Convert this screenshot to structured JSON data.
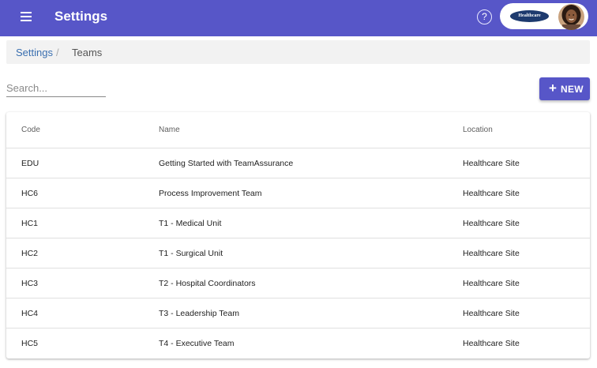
{
  "appbar": {
    "title": "Settings",
    "help_symbol": "?",
    "org_logo_text": "Healthcare",
    "icons": {
      "menu": "hamburger-menu-icon",
      "help": "help-circle-icon"
    }
  },
  "breadcrumb": {
    "parent": "Settings",
    "separator": "/",
    "current": "Teams"
  },
  "search": {
    "placeholder": "Search..."
  },
  "new_button": {
    "icon": "+",
    "label": "NEW"
  },
  "table": {
    "columns": [
      "Code",
      "Name",
      "Location"
    ],
    "rows": [
      {
        "code": "EDU",
        "name": "Getting Started with TeamAssurance",
        "location": "Healthcare Site"
      },
      {
        "code": "HC6",
        "name": "Process Improvement Team",
        "location": "Healthcare Site"
      },
      {
        "code": "HC1",
        "name": "T1 - Medical Unit",
        "location": "Healthcare Site"
      },
      {
        "code": "HC2",
        "name": "T1 - Surgical Unit",
        "location": "Healthcare Site"
      },
      {
        "code": "HC3",
        "name": "T2 - Hospital Coordinators",
        "location": "Healthcare Site"
      },
      {
        "code": "HC4",
        "name": "T3 - Leadership Team",
        "location": "Healthcare Site"
      },
      {
        "code": "HC5",
        "name": "T4 - Executive Team",
        "location": "Healthcare Site"
      }
    ]
  },
  "colors": {
    "primary": "#5756c8",
    "link": "#3a6fb0",
    "breadcrumb_bg": "#f2f2f2",
    "divider": "#e0e0e0"
  }
}
